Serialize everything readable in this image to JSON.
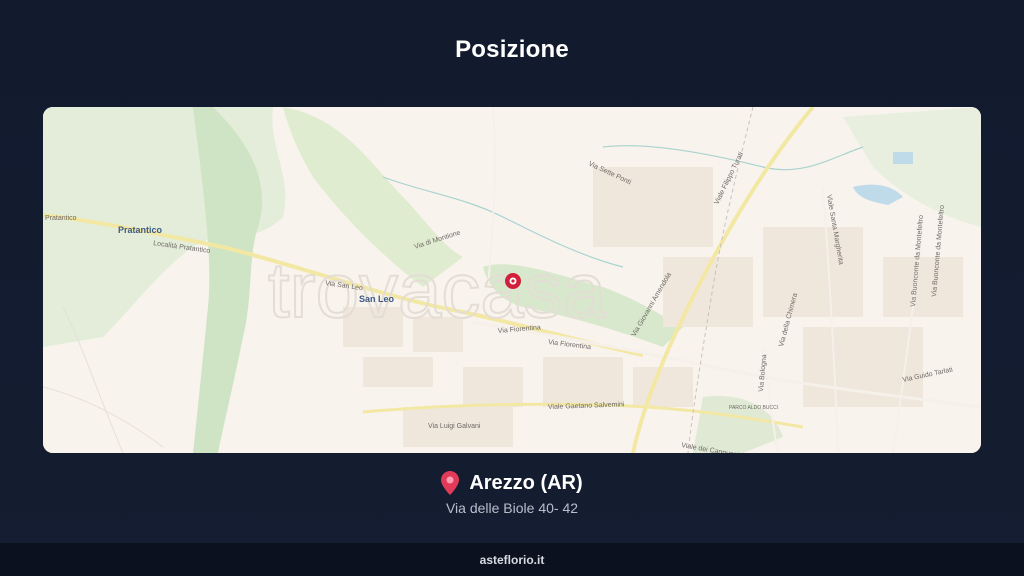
{
  "header": {
    "title": "Posizione"
  },
  "map": {
    "watermark": "trovacasa",
    "places": {
      "pratantico": "Pratantico",
      "san_leo": "San Leo"
    },
    "streets": {
      "pratantico_left": "Pratantico",
      "localita_pratantico": "Località Pratantico",
      "via_san_leo": "Via San Leo",
      "via_fiorentina_1": "Via Fiorentina",
      "via_fiorentina_2": "Via Fiorentina",
      "via_sette_ponti": "Via Sette Ponti",
      "via_filippo_turati": "Viale Filippo Turati",
      "via_santa_margherita": "Viale Santa Margherita",
      "via_buonconte": "Via Buonconte da Montefeltro",
      "via_buonconte_2": "Via Buonconte da Montefeltro",
      "via_gaetano_salvemini": "Viale Gaetano Salvemini",
      "via_luigi_galvani": "Via Luigi Galvani",
      "via_guido_tarlati": "Via Guido Tarlati",
      "via_bologna": "Via Bologna",
      "via_giovanni": "Via Giovanni Amendola",
      "via_di_montione": "Via di Montione",
      "via_della_chimera": "Via della Chimera",
      "via_dei_cappuccini": "Viale dei Cappuccini",
      "parco": "PARCO ALDO BUCCI"
    }
  },
  "location": {
    "icon": "map-pin-icon",
    "city": "Arezzo (AR)",
    "address": "Via delle Biole 40- 42"
  },
  "footer": {
    "brand": "asteflorio.it"
  },
  "colors": {
    "background": "#121a2e",
    "map_bg": "#f8f3ed",
    "marker": "#d21f3c",
    "green": "#cfe3c5",
    "road": "#f7e79a"
  }
}
